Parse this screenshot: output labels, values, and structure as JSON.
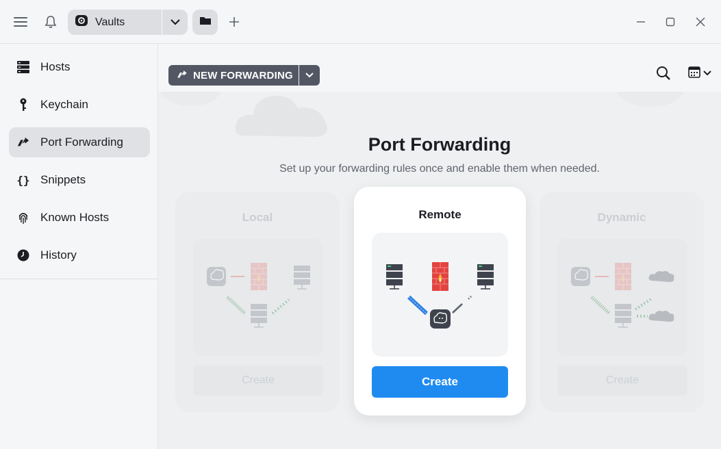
{
  "topbar": {
    "menu_icon": "hamburger-icon",
    "bell_icon": "bell-icon",
    "vault_label": "Vaults",
    "minimize_icon": "minimize-icon",
    "maximize_icon": "maximize-icon",
    "close_icon": "close-icon"
  },
  "sidebar": {
    "items": [
      {
        "label": "Hosts",
        "icon": "server-icon"
      },
      {
        "label": "Keychain",
        "icon": "key-icon"
      },
      {
        "label": "Port Forwarding",
        "icon": "port-forward-icon",
        "active": true
      },
      {
        "label": "Snippets",
        "icon": "braces-icon"
      },
      {
        "label": "Known Hosts",
        "icon": "fingerprint-icon"
      },
      {
        "label": "History",
        "icon": "clock-icon"
      }
    ]
  },
  "toolbar": {
    "new_forwarding_label": "NEW FORWARDING"
  },
  "hero": {
    "title": "Port Forwarding",
    "subtitle": "Set up your forwarding rules once and enable them when needed."
  },
  "cards": [
    {
      "title": "Local",
      "create_label": "Create"
    },
    {
      "title": "Remote",
      "create_label": "Create"
    },
    {
      "title": "Dynamic",
      "create_label": "Create"
    }
  ],
  "colors": {
    "accent": "#1f8bf1",
    "firewall": "#e2433f",
    "dark_button": "#535764"
  }
}
